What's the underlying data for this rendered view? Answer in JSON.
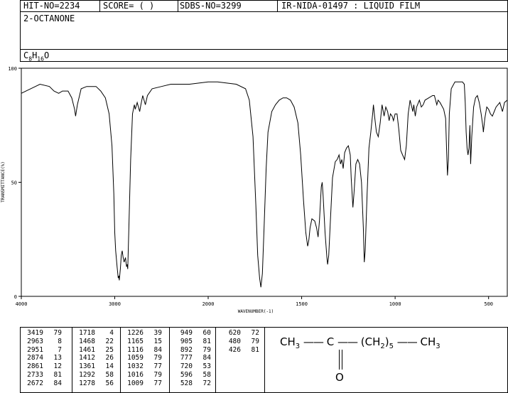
{
  "header": {
    "hit_no": "HIT-NO=2234",
    "score": "SCORE=  (   )",
    "sdbs_no": "SDBS-NO=3299",
    "ir_id": "IR-NIDA-01497 : LIQUID FILM"
  },
  "compound": {
    "name": "2-OCTANONE",
    "formula_c": "C",
    "formula_c_sub": "8",
    "formula_h": "H",
    "formula_h_sub": "16",
    "formula_o": "O"
  },
  "chart_data": {
    "type": "line",
    "xlabel": "WAVENUMBER(-1)",
    "ylabel": "TRANSMITTANCE(%)",
    "xlim": [
      4000,
      400
    ],
    "ylim": [
      0,
      100
    ],
    "x_ticks": [
      4000,
      3000,
      2000,
      1500,
      1000,
      500
    ],
    "y_ticks": [
      0,
      50,
      100
    ],
    "series": [
      {
        "points": [
          [
            4000,
            89
          ],
          [
            3900,
            91
          ],
          [
            3800,
            93
          ],
          [
            3700,
            92
          ],
          [
            3650,
            90
          ],
          [
            3600,
            89
          ],
          [
            3560,
            90
          ],
          [
            3500,
            90
          ],
          [
            3460,
            87
          ],
          [
            3430,
            82
          ],
          [
            3419,
            79
          ],
          [
            3400,
            84
          ],
          [
            3360,
            91
          ],
          [
            3300,
            92
          ],
          [
            3200,
            92
          ],
          [
            3150,
            90
          ],
          [
            3100,
            87
          ],
          [
            3060,
            80
          ],
          [
            3030,
            66
          ],
          [
            3010,
            45
          ],
          [
            3000,
            28
          ],
          [
            2990,
            20
          ],
          [
            2975,
            13
          ],
          [
            2963,
            8
          ],
          [
            2955,
            9
          ],
          [
            2951,
            7
          ],
          [
            2940,
            12
          ],
          [
            2930,
            18
          ],
          [
            2920,
            20
          ],
          [
            2910,
            17
          ],
          [
            2900,
            15
          ],
          [
            2885,
            17
          ],
          [
            2874,
            13
          ],
          [
            2868,
            14
          ],
          [
            2861,
            12
          ],
          [
            2850,
            28
          ],
          [
            2830,
            60
          ],
          [
            2810,
            80
          ],
          [
            2790,
            84
          ],
          [
            2780,
            82
          ],
          [
            2760,
            85
          ],
          [
            2733,
            81
          ],
          [
            2720,
            84
          ],
          [
            2700,
            88
          ],
          [
            2672,
            84
          ],
          [
            2650,
            88
          ],
          [
            2600,
            91
          ],
          [
            2500,
            92
          ],
          [
            2400,
            93
          ],
          [
            2300,
            93
          ],
          [
            2200,
            93
          ],
          [
            2100,
            93.5
          ],
          [
            2000,
            94
          ],
          [
            1950,
            94
          ],
          [
            1900,
            93.5
          ],
          [
            1850,
            93
          ],
          [
            1800,
            91
          ],
          [
            1780,
            86
          ],
          [
            1760,
            70
          ],
          [
            1745,
            40
          ],
          [
            1735,
            18
          ],
          [
            1725,
            8
          ],
          [
            1718,
            4
          ],
          [
            1710,
            10
          ],
          [
            1700,
            32
          ],
          [
            1690,
            56
          ],
          [
            1680,
            72
          ],
          [
            1660,
            81
          ],
          [
            1640,
            84
          ],
          [
            1620,
            86
          ],
          [
            1600,
            87
          ],
          [
            1580,
            87
          ],
          [
            1560,
            86
          ],
          [
            1540,
            83
          ],
          [
            1520,
            76
          ],
          [
            1505,
            62
          ],
          [
            1490,
            42
          ],
          [
            1478,
            28
          ],
          [
            1468,
            22
          ],
          [
            1465,
            23
          ],
          [
            1461,
            25
          ],
          [
            1455,
            30
          ],
          [
            1445,
            34
          ],
          [
            1430,
            33
          ],
          [
            1420,
            30
          ],
          [
            1412,
            26
          ],
          [
            1405,
            33
          ],
          [
            1395,
            48
          ],
          [
            1390,
            50
          ],
          [
            1385,
            44
          ],
          [
            1375,
            28
          ],
          [
            1365,
            17
          ],
          [
            1361,
            14
          ],
          [
            1355,
            18
          ],
          [
            1345,
            35
          ],
          [
            1335,
            52
          ],
          [
            1320,
            59
          ],
          [
            1310,
            60
          ],
          [
            1300,
            62
          ],
          [
            1292,
            58
          ],
          [
            1285,
            60
          ],
          [
            1278,
            56
          ],
          [
            1270,
            63
          ],
          [
            1260,
            65
          ],
          [
            1250,
            66
          ],
          [
            1240,
            62
          ],
          [
            1235,
            52
          ],
          [
            1226,
            39
          ],
          [
            1220,
            45
          ],
          [
            1210,
            58
          ],
          [
            1200,
            60
          ],
          [
            1190,
            58
          ],
          [
            1180,
            50
          ],
          [
            1170,
            30
          ],
          [
            1165,
            15
          ],
          [
            1160,
            20
          ],
          [
            1150,
            45
          ],
          [
            1140,
            65
          ],
          [
            1130,
            72
          ],
          [
            1125,
            76
          ],
          [
            1120,
            80
          ],
          [
            1116,
            84
          ],
          [
            1110,
            79
          ],
          [
            1100,
            72
          ],
          [
            1090,
            70
          ],
          [
            1080,
            76
          ],
          [
            1070,
            84
          ],
          [
            1059,
            79
          ],
          [
            1050,
            83
          ],
          [
            1040,
            81
          ],
          [
            1032,
            77
          ],
          [
            1025,
            80
          ],
          [
            1016,
            79
          ],
          [
            1009,
            77
          ],
          [
            1000,
            80
          ],
          [
            990,
            80
          ],
          [
            980,
            73
          ],
          [
            970,
            64
          ],
          [
            960,
            62
          ],
          [
            949,
            60
          ],
          [
            940,
            66
          ],
          [
            930,
            80
          ],
          [
            920,
            86
          ],
          [
            905,
            81
          ],
          [
            900,
            84
          ],
          [
            892,
            79
          ],
          [
            885,
            83
          ],
          [
            870,
            86
          ],
          [
            860,
            83
          ],
          [
            850,
            84
          ],
          [
            840,
            86
          ],
          [
            820,
            87
          ],
          [
            800,
            88
          ],
          [
            790,
            88
          ],
          [
            777,
            84
          ],
          [
            770,
            86
          ],
          [
            760,
            85
          ],
          [
            740,
            82
          ],
          [
            730,
            78
          ],
          [
            725,
            65
          ],
          [
            720,
            53
          ],
          [
            715,
            60
          ],
          [
            710,
            80
          ],
          [
            700,
            91
          ],
          [
            680,
            94
          ],
          [
            660,
            94
          ],
          [
            640,
            94
          ],
          [
            630,
            93
          ],
          [
            625,
            85
          ],
          [
            620,
            72
          ],
          [
            615,
            65
          ],
          [
            610,
            62
          ],
          [
            605,
            65
          ],
          [
            600,
            75
          ],
          [
            596,
            58
          ],
          [
            590,
            70
          ],
          [
            580,
            83
          ],
          [
            570,
            87
          ],
          [
            560,
            88
          ],
          [
            550,
            85
          ],
          [
            540,
            80
          ],
          [
            530,
            74
          ],
          [
            528,
            72
          ],
          [
            520,
            78
          ],
          [
            510,
            83
          ],
          [
            500,
            82
          ],
          [
            490,
            80
          ],
          [
            480,
            79
          ],
          [
            470,
            81
          ],
          [
            460,
            83
          ],
          [
            450,
            84
          ],
          [
            440,
            85
          ],
          [
            426,
            81
          ],
          [
            415,
            85
          ],
          [
            400,
            86
          ]
        ]
      }
    ]
  },
  "peak_table": {
    "columns": [
      [
        [
          "3419",
          "79"
        ],
        [
          "2963",
          "8"
        ],
        [
          "2951",
          "7"
        ],
        [
          "2874",
          "13"
        ],
        [
          "2861",
          "12"
        ],
        [
          "2733",
          "81"
        ],
        [
          "2672",
          "84"
        ]
      ],
      [
        [
          "1718",
          "4"
        ],
        [
          "1468",
          "22"
        ],
        [
          "1461",
          "25"
        ],
        [
          "1412",
          "26"
        ],
        [
          "1361",
          "14"
        ],
        [
          "1292",
          "58"
        ],
        [
          "1278",
          "56"
        ]
      ],
      [
        [
          "1226",
          "39"
        ],
        [
          "1165",
          "15"
        ],
        [
          "1116",
          "84"
        ],
        [
          "1059",
          "79"
        ],
        [
          "1032",
          "77"
        ],
        [
          "1016",
          "79"
        ],
        [
          "1009",
          "77"
        ]
      ],
      [
        [
          "949",
          "60"
        ],
        [
          "905",
          "81"
        ],
        [
          "892",
          "79"
        ],
        [
          "777",
          "84"
        ],
        [
          "720",
          "53"
        ],
        [
          "596",
          "58"
        ],
        [
          "528",
          "72"
        ]
      ],
      [
        [
          "620",
          "72"
        ],
        [
          "480",
          "79"
        ],
        [
          "426",
          "81"
        ]
      ]
    ]
  },
  "structure": {
    "left_group": "CH",
    "left_sub": "3",
    "center_atom": "C",
    "chain_open": "(CH",
    "chain_sub": "2",
    "chain_close": ")",
    "chain_count": "5",
    "right_group": "CH",
    "right_sub": "3",
    "double_bond_atom": "O"
  }
}
